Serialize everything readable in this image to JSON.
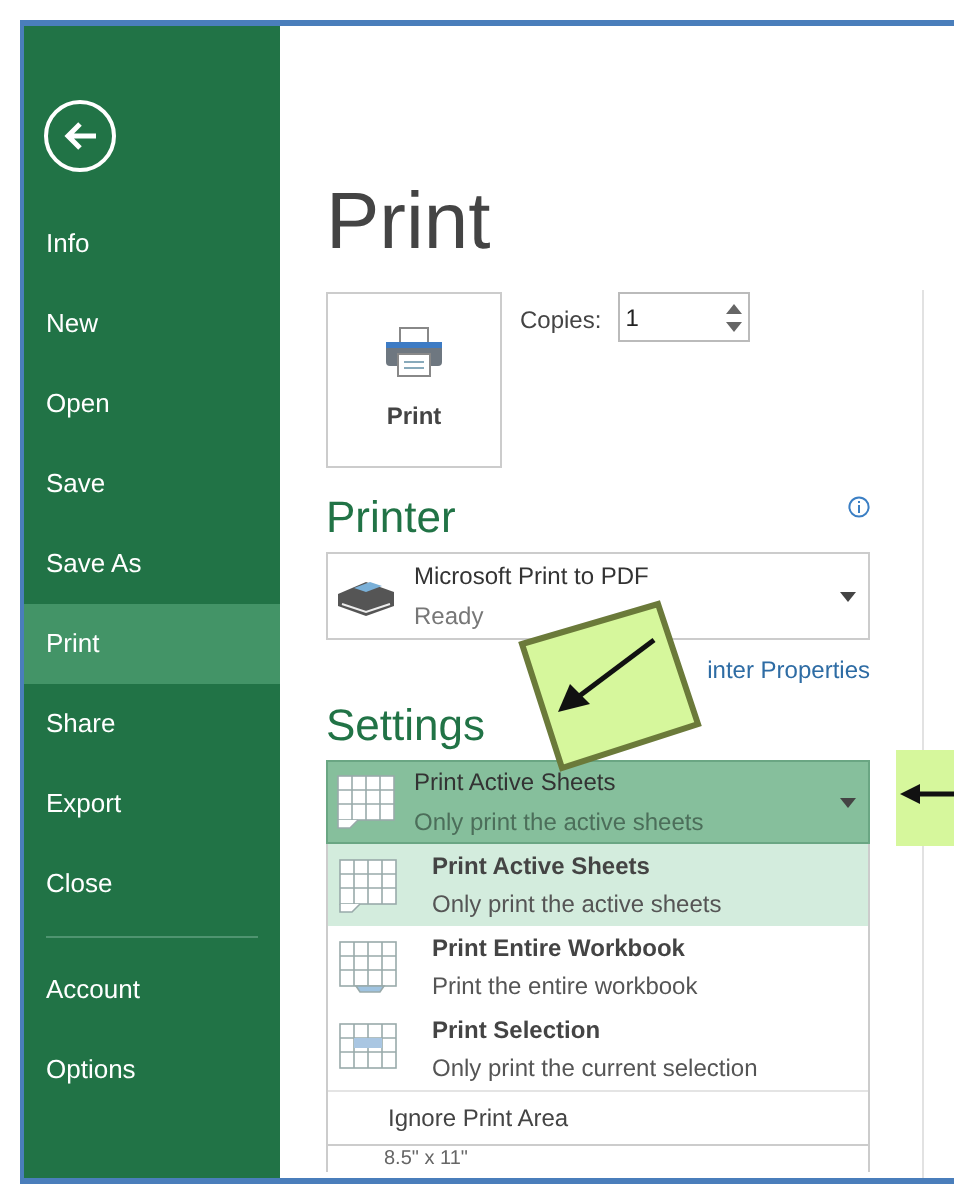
{
  "sidebar": {
    "items": [
      {
        "label": "Info",
        "selected": false
      },
      {
        "label": "New",
        "selected": false
      },
      {
        "label": "Open",
        "selected": false
      },
      {
        "label": "Save",
        "selected": false
      },
      {
        "label": "Save As",
        "selected": false
      },
      {
        "label": "Print",
        "selected": true
      },
      {
        "label": "Share",
        "selected": false
      },
      {
        "label": "Export",
        "selected": false
      },
      {
        "label": "Close",
        "selected": false
      }
    ],
    "footer_items": [
      {
        "label": "Account",
        "selected": false
      },
      {
        "label": "Options",
        "selected": false
      }
    ]
  },
  "title": "Print",
  "print_button": {
    "label": "Print"
  },
  "copies": {
    "label": "Copies:",
    "value": "1"
  },
  "printer": {
    "heading": "Printer",
    "name": "Microsoft Print to PDF",
    "status": "Ready",
    "properties_link": "inter Properties"
  },
  "settings": {
    "heading": "Settings",
    "current": {
      "title": "Print Active Sheets",
      "subtitle": "Only print the active sheets"
    },
    "options": [
      {
        "kind": "active",
        "title": "Print Active Sheets",
        "subtitle": "Only print the active sheets",
        "selected": true
      },
      {
        "kind": "workbook",
        "title": "Print Entire Workbook",
        "subtitle": "Print the entire workbook",
        "selected": false
      },
      {
        "kind": "selection",
        "title": "Print Selection",
        "subtitle": "Only print the current selection",
        "selected": false
      }
    ],
    "ignore_print_area": "Ignore Print Area",
    "paper_size": "8.5\" x 11\""
  }
}
